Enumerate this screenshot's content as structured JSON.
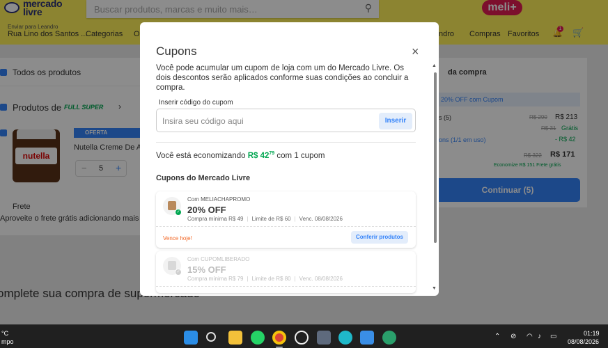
{
  "header": {
    "logo_text": "mercado\nlivre",
    "search_placeholder": "Buscar produtos, marcas e muito mais…",
    "meli_plus": "meli+",
    "location_label": "Enviar para Leandro",
    "location_address": "Rua Lino dos Santos ...",
    "nav": [
      "Categorias",
      "O",
      "ndro",
      "Compras",
      "Favoritos"
    ],
    "cart_badge": "1",
    "cart_count": "5"
  },
  "cart": {
    "all_products": "Todos os produtos",
    "products_of": "Produtos de",
    "full_super": "FULL SUPER",
    "offer_badge": "OFERTA IMPERDÍVEL",
    "product_name": "Nutella Creme De A",
    "product_brand": "nutella",
    "quantity": "5",
    "shipping_title": "Frete",
    "shipping_text": "Aproveite o frete grátis adicionando mais",
    "complete_text": "omplete sua compra de supermercado"
  },
  "summary": {
    "title": "da compra",
    "coupon_banner": "20% OFF com Cupom",
    "rows": [
      {
        "label": "s (5)",
        "old": "R$ 290",
        "value": "R$ 213"
      },
      {
        "label": "",
        "old": "R$ 31",
        "value": "Grátis"
      },
      {
        "label": "ons (1/1 em uso)",
        "old": "",
        "value": "- R$ 42"
      }
    ],
    "total_old": "R$ 322",
    "total": "R$ 171",
    "savings_line": "Economize R$ 151  Frete grátis",
    "continue_button": "Continuar (5)"
  },
  "modal": {
    "title": "Cupons",
    "close_symbol": "×",
    "description": "Você pode acumular um cupom de loja com um do Mercado Livre. Os dois descontos serão aplicados conforme suas condições ao concluir a compra.",
    "input_label": "Inserir código do cupom",
    "input_placeholder": "Insira seu código aqui",
    "insert_button": "Inserir",
    "savings_prefix": "Você está economizando",
    "savings_amount": "R$ 42",
    "savings_cents": "79",
    "savings_suffix": "com 1 cupom",
    "section_title": "Cupons do Mercado Livre",
    "coupons": [
      {
        "code": "Com MELIACHAPROMO",
        "discount": "20% OFF",
        "minimum": "Compra mínima R$ 49",
        "limit": "Limite de R$ 60",
        "expiry": "Venc. 08/08/2026",
        "footer_note": "Vence hoje!",
        "action": "Conferir produtos",
        "applied": true
      },
      {
        "code": "Com CUPOMLIBERADO",
        "discount": "15% OFF",
        "minimum": "Compra mínima R$ 79",
        "limit": "Limite de R$ 80",
        "expiry": "Venc. 08/08/2026",
        "applied": false
      }
    ]
  },
  "taskbar": {
    "weather_temp": "°C",
    "weather_text": "mpo",
    "time": "01:19",
    "date": "08/08/2026"
  },
  "colors": {
    "brand_yellow": "#fff159",
    "accent_blue": "#3483fa",
    "success_green": "#00a650",
    "warning_orange": "#f26522"
  }
}
